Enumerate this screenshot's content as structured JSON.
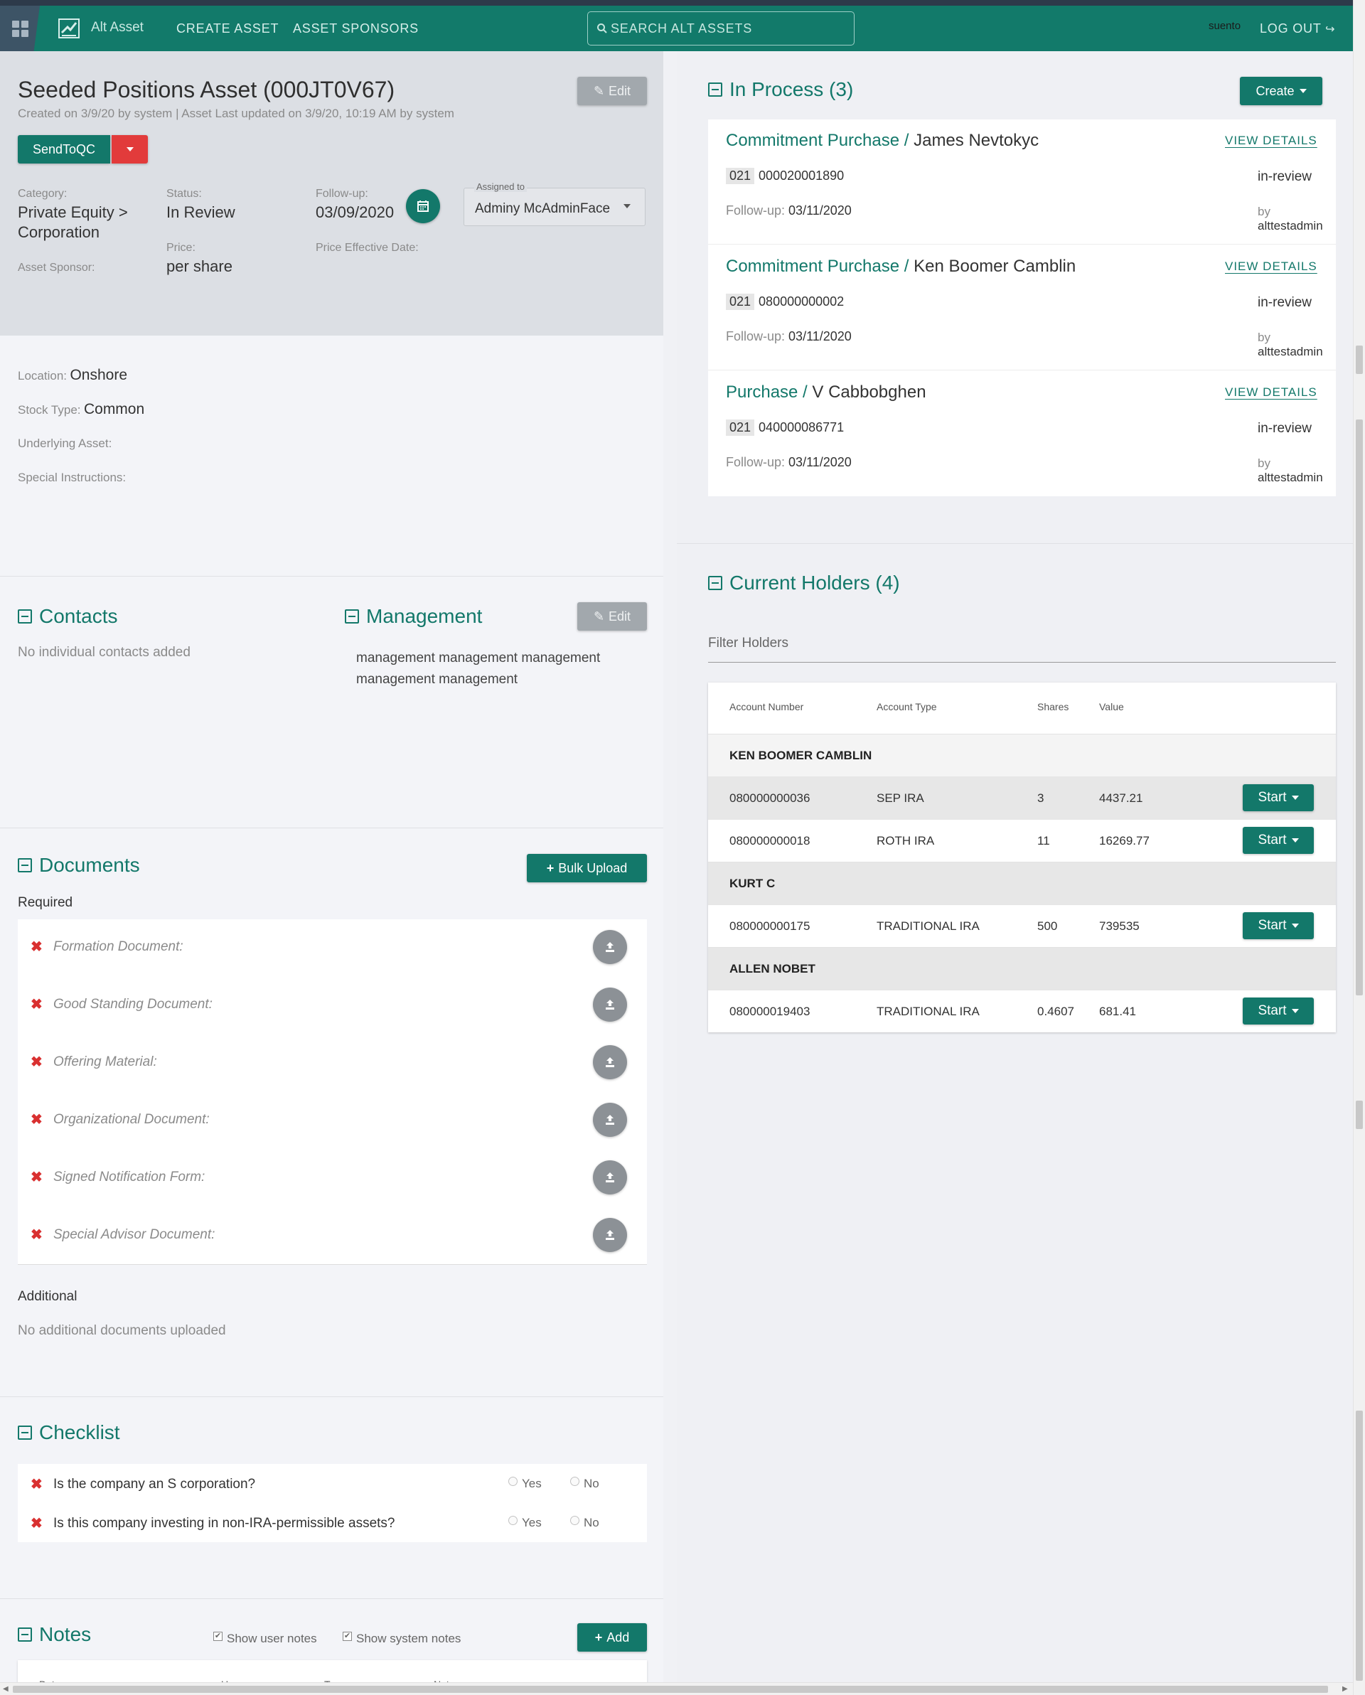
{
  "nav": {
    "brand": "Alt Asset",
    "links": [
      "CREATE ASSET",
      "ASSET SPONSORS"
    ],
    "search_placeholder": "SEARCH ALT ASSETS",
    "username": "suento",
    "logout": "LOG OUT"
  },
  "asset": {
    "title": "Seeded Positions Asset (000JT0V67)",
    "meta": "Created on 3/9/20 by system | Asset Last updated on 3/9/20, 10:19 AM by system",
    "edit_label": "Edit",
    "send_label": "SendToQC",
    "category_label": "Category:",
    "category_value_1": "Private Equity >",
    "category_value_2": "Corporation",
    "status_label": "Status:",
    "status_value": "In Review",
    "followup_label": "Follow-up:",
    "followup_value": "03/09/2020",
    "assigned_label": "Assigned to",
    "assigned_value": "Adminy McAdminFace",
    "sponsor_label": "Asset Sponsor:",
    "price_label": "Price:",
    "price_value": "per share",
    "price_date_label": "Price Effective Date:"
  },
  "details": {
    "location_label": "Location:",
    "location_value": "Onshore",
    "stock_label": "Stock Type:",
    "stock_value": "Common",
    "underlying_label": "Underlying Asset:",
    "special_label": "Special Instructions:"
  },
  "contacts": {
    "heading": "Contacts",
    "empty": "No individual contacts added"
  },
  "management": {
    "heading": "Management",
    "edit_label": "Edit",
    "text_line1": "management management management",
    "text_line2": "management management"
  },
  "documents": {
    "heading": "Documents",
    "bulk_label": "Bulk Upload",
    "required_label": "Required",
    "items": [
      "Formation Document:",
      "Good Standing Document:",
      "Offering Material:",
      "Organizational Document:",
      "Signed Notification Form:",
      "Special Advisor Document:"
    ],
    "additional_label": "Additional",
    "additional_empty": "No additional documents uploaded"
  },
  "checklist": {
    "heading": "Checklist",
    "yes": "Yes",
    "no": "No",
    "questions": [
      "Is the company an S corporation?",
      "Is this company investing in non-IRA-permissible assets?"
    ]
  },
  "notes": {
    "heading": "Notes",
    "show_user": "Show user notes",
    "show_system": "Show system notes",
    "add_label": "Add",
    "columns": [
      "Date",
      "User",
      "Type",
      "Note"
    ]
  },
  "in_process": {
    "heading": "In Process (3)",
    "create_label": "Create",
    "view_label": "VIEW DETAILS",
    "followup_label": "Follow-up:",
    "by_label": "by",
    "items": [
      {
        "type": "Commitment Purchase",
        "name": "James Nevtokyc",
        "code": "021",
        "account": "000020001890",
        "status": "in-review",
        "followup": "03/11/2020",
        "user": "alttestadmin"
      },
      {
        "type": "Commitment Purchase",
        "name": "Ken Boomer Camblin",
        "code": "021",
        "account": "080000000002",
        "status": "in-review",
        "followup": "03/11/2020",
        "user": "alttestadmin"
      },
      {
        "type": "Purchase",
        "name": "V Cabbobghen",
        "code": "021",
        "account": "040000086771",
        "status": "in-review",
        "followup": "03/11/2020",
        "user": "alttestadmin"
      }
    ]
  },
  "holders": {
    "heading": "Current Holders (4)",
    "filter_placeholder": "Filter Holders",
    "columns": [
      "Account Number",
      "Account Type",
      "Shares",
      "Value"
    ],
    "start_label": "Start",
    "groups": [
      {
        "name": "KEN BOOMER CAMBLIN",
        "rows": [
          {
            "account": "080000000036",
            "type": "SEP IRA",
            "shares": "3",
            "value": "4437.21"
          },
          {
            "account": "080000000018",
            "type": "ROTH IRA",
            "shares": "11",
            "value": "16269.77"
          }
        ]
      },
      {
        "name": "KURT C",
        "rows": [
          {
            "account": "080000000175",
            "type": "TRADITIONAL IRA",
            "shares": "500",
            "value": "739535"
          }
        ]
      },
      {
        "name": "ALLEN NOBET",
        "rows": [
          {
            "account": "080000019403",
            "type": "TRADITIONAL IRA",
            "shares": "0.4607",
            "value": "681.41"
          }
        ]
      }
    ]
  },
  "colors": {
    "primary": "#13786a",
    "danger": "#e23b3b",
    "header_bg": "#dcdfe4",
    "topbar": "#127a6a"
  }
}
